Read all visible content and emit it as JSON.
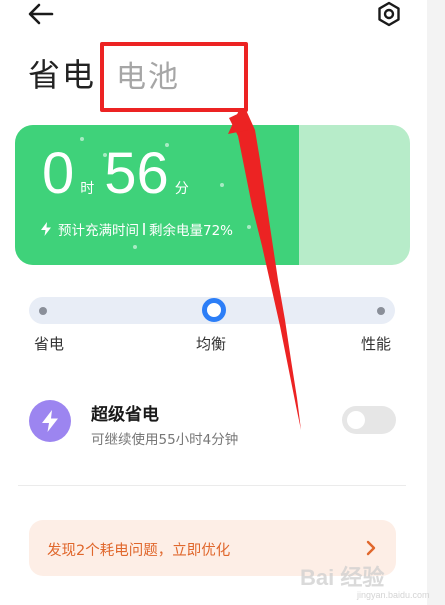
{
  "header": {
    "back_icon": "arrow-left-icon",
    "settings_icon": "gear-icon"
  },
  "tabs": [
    {
      "label": "省电",
      "active": true
    },
    {
      "label": "电池",
      "active": false
    }
  ],
  "battery": {
    "hours": "0",
    "hours_unit": "时",
    "minutes": "56",
    "minutes_unit": "分",
    "charge_label": "预计充满时间",
    "remaining_label": "剩余电量72%",
    "level_percent": 72,
    "fill_color": "#3fd27a",
    "track_color": "#b7ecc9"
  },
  "modes": {
    "options": [
      "省电",
      "均衡",
      "性能"
    ],
    "selected": "均衡",
    "accent_color": "#2c7ef7"
  },
  "super_saving": {
    "title": "超级省电",
    "description": "可继续使用55小时4分钟",
    "enabled": false,
    "icon": "lightning-icon"
  },
  "issue_banner": {
    "text": "发现2个耗电问题，立即优化",
    "color": "#e0672c"
  },
  "annotation": {
    "color": "#ec2323"
  },
  "watermark": {
    "text": "Bai 经验",
    "sub": "jingyan.baidu.com"
  }
}
